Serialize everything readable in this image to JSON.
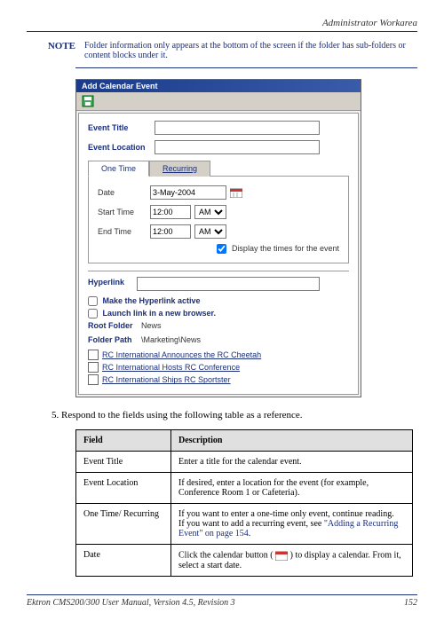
{
  "header": {
    "title": "Administrator Workarea"
  },
  "note": {
    "label": "NOTE",
    "text": "Folder information only appears at the bottom of the screen if the folder has sub-folders or content blocks under it."
  },
  "dialog": {
    "title": "Add Calendar Event",
    "fields": {
      "event_title_label": "Event Title",
      "event_title_value": "",
      "event_location_label": "Event Location",
      "event_location_value": "",
      "tabs": {
        "one_time": "One Time",
        "recurring": "Recurring"
      },
      "date_label": "Date",
      "date_value": "3-May-2004",
      "start_time_label": "Start Time",
      "start_time_value": "12:00",
      "start_time_ampm": "AM",
      "end_time_label": "End Time",
      "end_time_value": "12:00",
      "end_time_ampm": "AM",
      "display_times_label": "Display the times for the event",
      "hyperlink_label": "Hyperlink",
      "hyperlink_value": "",
      "make_active_label": "Make the Hyperlink active",
      "launch_new_label": "Launch link in a new browser.",
      "root_folder_label": "Root Folder",
      "root_folder_value": "News",
      "folder_path_label": "Folder Path",
      "folder_path_value": "\\Marketing\\News"
    },
    "files": [
      "RC International Announces the RC Cheetah",
      "RC International Hosts RC Conference",
      "RC International Ships RC Sportster"
    ]
  },
  "step": {
    "number": "5.",
    "text": "Respond to the fields using the following table as a reference."
  },
  "table": {
    "headers": {
      "field": "Field",
      "description": "Description"
    },
    "rows": [
      {
        "field": "Event Title",
        "description": "Enter a title for the calendar event."
      },
      {
        "field": "Event Location",
        "description": "If desired, enter a location for the event (for example, Conference Room 1 or Cafeteria)."
      },
      {
        "field": "One Time/ Recurring",
        "description": "If you want to enter a one-time only event, continue reading.",
        "extra": "If you want to add a recurring event, see ",
        "link": "\"Adding a Recurring Event\" on page 154",
        "after": "."
      },
      {
        "field": "Date",
        "description_pre": "Click the calendar button ( ",
        "description_post": " ) to display a calendar. From it, select a start date."
      }
    ]
  },
  "footer": {
    "left": "Ektron CMS200/300 User Manual, Version 4.5, Revision 3",
    "right": "152"
  }
}
